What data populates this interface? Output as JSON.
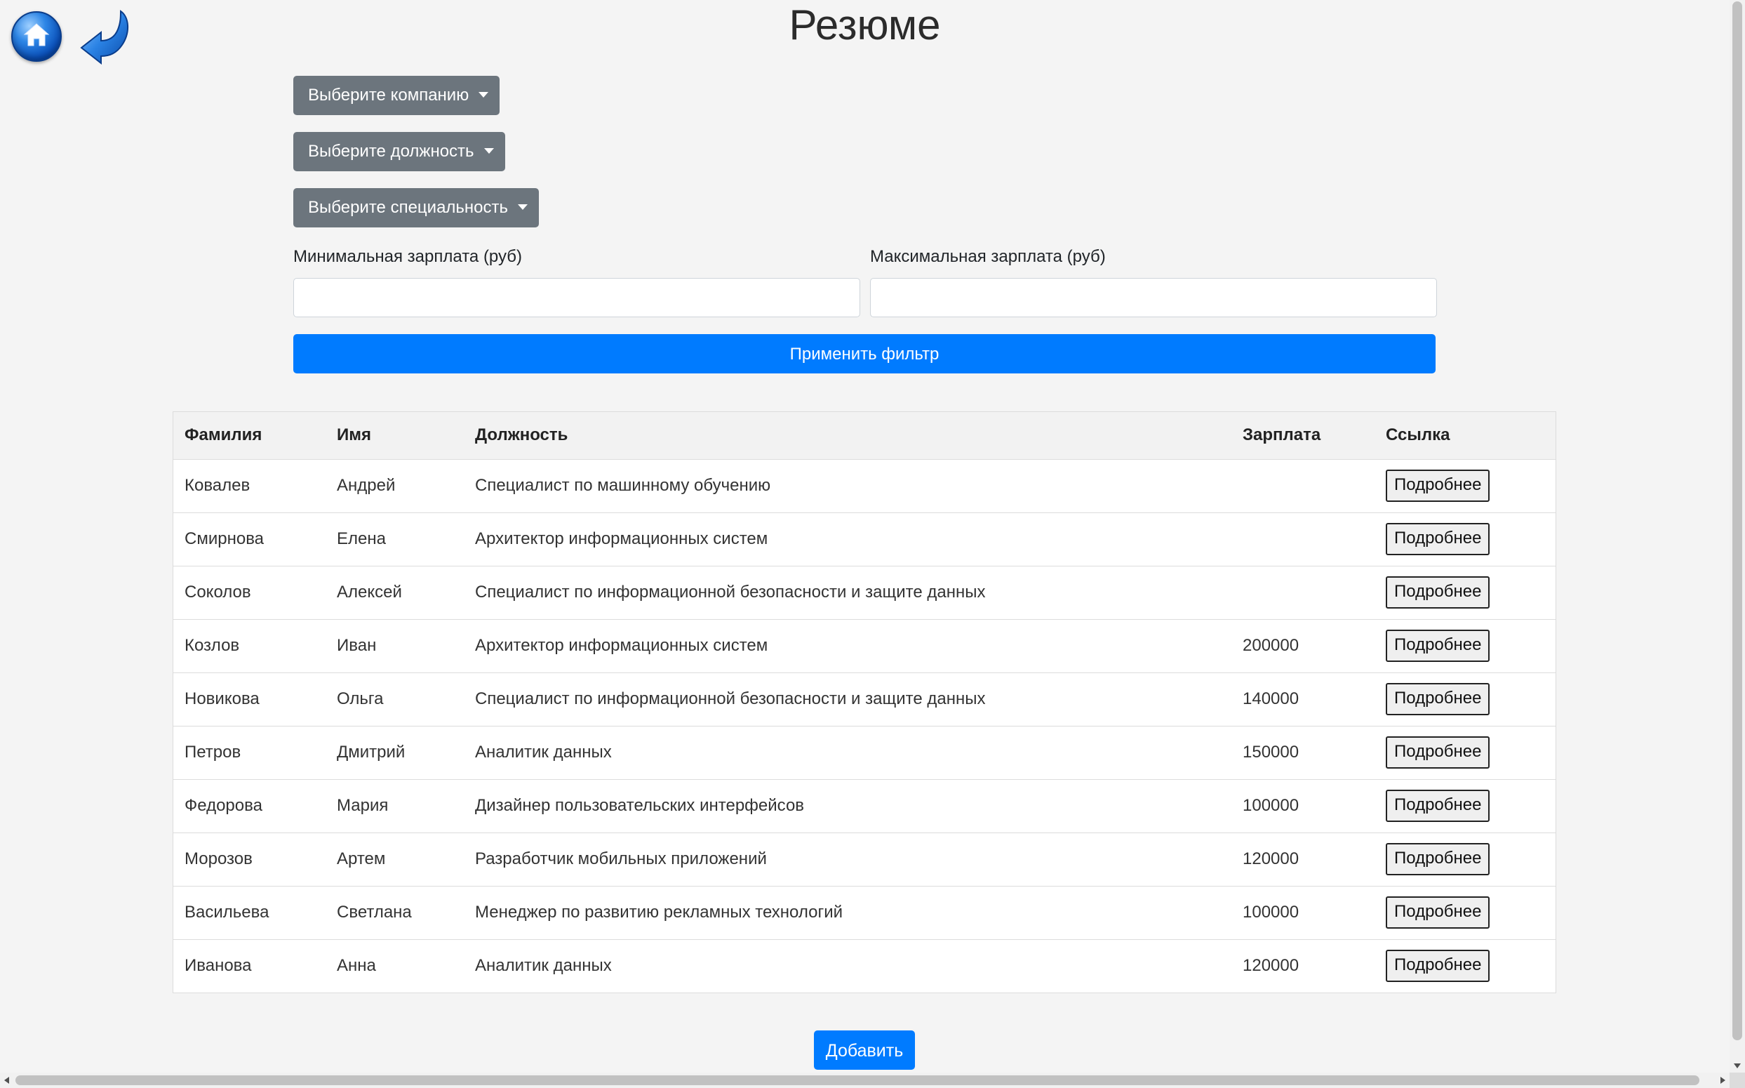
{
  "header": {
    "title": "Резюме",
    "home_icon": "home-icon",
    "back_icon": "back-arrow-icon"
  },
  "filters": {
    "company_label": "Выберите компанию",
    "position_label": "Выберите должность",
    "specialty_label": "Выберите специальность",
    "min_salary_label": "Минимальная зарплата (руб)",
    "max_salary_label": "Максимальная зарплата (руб)",
    "min_salary_value": "",
    "max_salary_value": "",
    "apply_label": "Применить фильтр"
  },
  "table": {
    "columns": [
      "Фамилия",
      "Имя",
      "Должность",
      "Зарплата",
      "Ссылка"
    ],
    "details_label": "Подробнее",
    "rows": [
      {
        "surname": "Ковалев",
        "name": "Андрей",
        "position": "Специалист по машинному обучению",
        "salary": ""
      },
      {
        "surname": "Смирнова",
        "name": "Елена",
        "position": "Архитектор информационных систем",
        "salary": ""
      },
      {
        "surname": "Соколов",
        "name": "Алексей",
        "position": "Специалист по информационной безопасности и защите данных",
        "salary": ""
      },
      {
        "surname": "Козлов",
        "name": "Иван",
        "position": "Архитектор информационных систем",
        "salary": "200000"
      },
      {
        "surname": "Новикова",
        "name": "Ольга",
        "position": "Специалист по информационной безопасности и защите данных",
        "salary": "140000"
      },
      {
        "surname": "Петров",
        "name": "Дмитрий",
        "position": "Аналитик данных",
        "salary": "150000"
      },
      {
        "surname": "Федорова",
        "name": "Мария",
        "position": "Дизайнер пользовательских интерфейсов",
        "salary": "100000"
      },
      {
        "surname": "Морозов",
        "name": "Артем",
        "position": "Разработчик мобильных приложений",
        "salary": "120000"
      },
      {
        "surname": "Васильева",
        "name": "Светлана",
        "position": "Менеджер по развитию рекламных технологий",
        "salary": "100000"
      },
      {
        "surname": "Иванова",
        "name": "Анна",
        "position": "Аналитик данных",
        "salary": "120000"
      }
    ]
  },
  "actions": {
    "add_label": "Добавить"
  },
  "colors": {
    "primary": "#007bff",
    "secondary": "#6c757d",
    "background": "#f4f4f4"
  }
}
